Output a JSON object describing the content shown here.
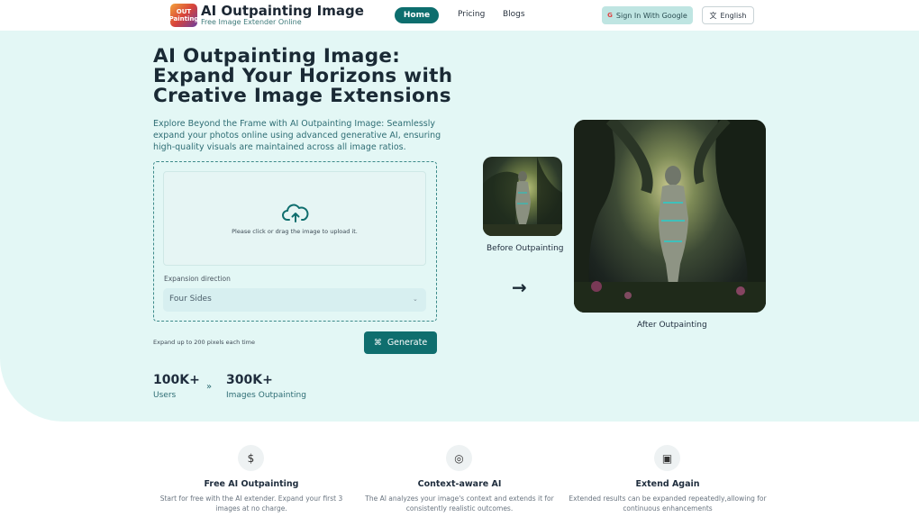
{
  "header": {
    "logo_text": "OUT Painting",
    "title": "AI Outpainting Image",
    "subtitle": "Free Image Extender Online",
    "nav": [
      {
        "label": "Home"
      },
      {
        "label": "Pricing"
      },
      {
        "label": "Blogs"
      }
    ],
    "sign_in_label": "Sign In With Google",
    "language_label": "English",
    "language_icon": "translate-icon"
  },
  "hero": {
    "title_line1": "AI Outpainting Image:",
    "title_line2": "Expand Your Horizons with",
    "title_line3": "Creative Image Extensions",
    "description": "Explore Beyond the Frame with AI Outpainting Image: Seamlessly expand your photos online using advanced generative AI, ensuring high-quality visuals are maintained across all image ratios."
  },
  "uploader": {
    "drop_text": "Please click or drag the image to upload it.",
    "upload_icon": "cloud-upload-icon",
    "expansion_label": "Expansion direction",
    "expansion_value": "Four Sides",
    "note": "Expand up to 200 pixels each time",
    "generate_label": "Generate"
  },
  "stats": [
    {
      "value": "100K+",
      "label": "Users"
    },
    {
      "value": "300K+",
      "label": "Images Outpainting"
    }
  ],
  "preview": {
    "before_label": "Before Outpainting",
    "after_label": "After Outpainting"
  },
  "features": [
    {
      "icon": "dollar-icon",
      "title": "Free AI Outpainting",
      "description": "Start for free with the AI extender. Expand your first 3 images at no charge."
    },
    {
      "icon": "brain-icon",
      "title": "Context-aware AI",
      "description": "The AI analyzes your image's context and extends it for consistently realistic outcomes."
    },
    {
      "icon": "extend-icon",
      "title": "Extend Again",
      "description": "Extended results can be expanded repeatedly,allowing for continuous enhancements"
    }
  ],
  "colors": {
    "accent": "#0f6e6e",
    "hero_bg": "#e3f7f5"
  }
}
